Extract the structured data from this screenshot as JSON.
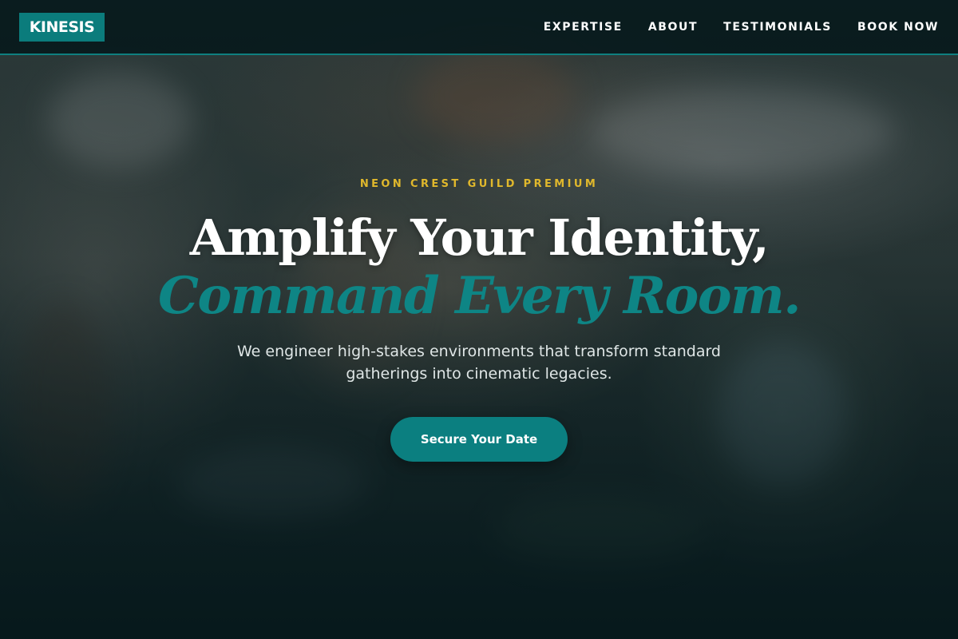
{
  "brand": {
    "logo_text": "KINESIS"
  },
  "nav": {
    "items": [
      {
        "label": "EXPERTISE"
      },
      {
        "label": "ABOUT"
      },
      {
        "label": "TESTIMONIALS"
      },
      {
        "label": "BOOK NOW"
      }
    ]
  },
  "hero": {
    "eyebrow": "NEON CREST GUILD PREMIUM",
    "headline_line1": "Amplify Your Identity,",
    "headline_line2": "Command Every Room.",
    "subtext": "We engineer high-stakes environments that transform standard gatherings into cinematic legacies.",
    "cta_label": "Secure Your Date"
  },
  "colors": {
    "accent_teal": "#0b7f80",
    "eyebrow_gold": "#e0b82c",
    "header_bg": "#06181b"
  }
}
